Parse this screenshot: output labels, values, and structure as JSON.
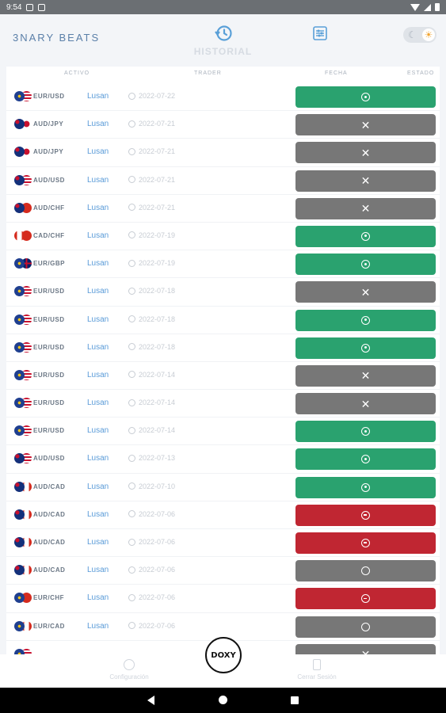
{
  "status_bar": {
    "time": "9:54"
  },
  "header": {
    "brand_small": "",
    "brand_name": "3NARY BEATS",
    "title": "HISTORIAL",
    "icons": {
      "history": "history-icon",
      "filter": "filter-icon",
      "moon": "moon-icon",
      "sun": "sun-icon"
    }
  },
  "table": {
    "columns": [
      "ACTIVO",
      "TRADER",
      "FECHA",
      "ESTADO"
    ],
    "rows": [
      {
        "asset": "EUR/USD",
        "flags": [
          "eu",
          "us"
        ],
        "trader": "Lusan",
        "date": "2022-07-22",
        "status": "win"
      },
      {
        "asset": "AUD/JPY",
        "flags": [
          "au",
          "jp"
        ],
        "trader": "Lusan",
        "date": "2022-07-21",
        "status": "loss"
      },
      {
        "asset": "AUD/JPY",
        "flags": [
          "au",
          "jp"
        ],
        "trader": "Lusan",
        "date": "2022-07-21",
        "status": "loss"
      },
      {
        "asset": "AUD/USD",
        "flags": [
          "au",
          "us"
        ],
        "trader": "Lusan",
        "date": "2022-07-21",
        "status": "loss"
      },
      {
        "asset": "AUD/CHF",
        "flags": [
          "au",
          "ch"
        ],
        "trader": "Lusan",
        "date": "2022-07-21",
        "status": "loss"
      },
      {
        "asset": "CAD/CHF",
        "flags": [
          "ca",
          "ch"
        ],
        "trader": "Lusan",
        "date": "2022-07-19",
        "status": "win"
      },
      {
        "asset": "EUR/GBP",
        "flags": [
          "eu",
          "gb"
        ],
        "trader": "Lusan",
        "date": "2022-07-19",
        "status": "win"
      },
      {
        "asset": "EUR/USD",
        "flags": [
          "eu",
          "us"
        ],
        "trader": "Lusan",
        "date": "2022-07-18",
        "status": "loss"
      },
      {
        "asset": "EUR/USD",
        "flags": [
          "eu",
          "us"
        ],
        "trader": "Lusan",
        "date": "2022-07-18",
        "status": "win"
      },
      {
        "asset": "EUR/USD",
        "flags": [
          "eu",
          "us"
        ],
        "trader": "Lusan",
        "date": "2022-07-18",
        "status": "win"
      },
      {
        "asset": "EUR/USD",
        "flags": [
          "eu",
          "us"
        ],
        "trader": "Lusan",
        "date": "2022-07-14",
        "status": "loss"
      },
      {
        "asset": "EUR/USD",
        "flags": [
          "eu",
          "us"
        ],
        "trader": "Lusan",
        "date": "2022-07-14",
        "status": "loss"
      },
      {
        "asset": "EUR/USD",
        "flags": [
          "eu",
          "us"
        ],
        "trader": "Lusan",
        "date": "2022-07-14",
        "status": "win"
      },
      {
        "asset": "AUD/USD",
        "flags": [
          "au",
          "us"
        ],
        "trader": "Lusan",
        "date": "2022-07-13",
        "status": "win"
      },
      {
        "asset": "AUD/CAD",
        "flags": [
          "au",
          "ca"
        ],
        "trader": "Lusan",
        "date": "2022-07-10",
        "status": "win"
      },
      {
        "asset": "AUD/CAD",
        "flags": [
          "au",
          "ca"
        ],
        "trader": "Lusan",
        "date": "2022-07-06",
        "status": "red"
      },
      {
        "asset": "AUD/CAD",
        "flags": [
          "au",
          "ca"
        ],
        "trader": "Lusan",
        "date": "2022-07-06",
        "status": "red"
      },
      {
        "asset": "AUD/CAD",
        "flags": [
          "au",
          "ca"
        ],
        "trader": "Lusan",
        "date": "2022-07-06",
        "status": "neutral"
      },
      {
        "asset": "EUR/CHF",
        "flags": [
          "eu",
          "ch"
        ],
        "trader": "Lusan",
        "date": "2022-07-06",
        "status": "red"
      },
      {
        "asset": "EUR/CAD",
        "flags": [
          "eu",
          "ca"
        ],
        "trader": "Lusan",
        "date": "2022-07-06",
        "status": "neutral"
      },
      {
        "asset": "",
        "flags": [
          "eu",
          "us"
        ],
        "trader": "",
        "date": "",
        "status": "loss"
      }
    ]
  },
  "status_icons": {
    "win": "arrow-circle-icon",
    "loss": "close-icon",
    "red": "minus-circle-icon",
    "neutral": "empty-circle-icon"
  },
  "colors": {
    "win": "#2aa26f",
    "loss": "#777777",
    "red": "#c02632",
    "neutral": "#777777",
    "trader": "#5a9bd8"
  },
  "bottom_nav": {
    "config_label": "Configuración",
    "logout_label": "Cerrar Sesión",
    "fab_label": "DOXY"
  }
}
